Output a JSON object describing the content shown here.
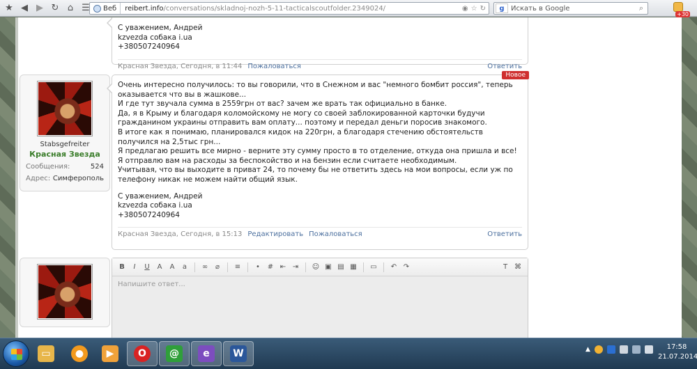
{
  "browser": {
    "site_label": "Веб",
    "url_host": "reibert.info",
    "url_path": "/conversations/skladnoj-nozh-5-11-tacticalscoutfolder.2349024/",
    "search_placeholder": "Искать в Google",
    "search_engine_letter": "g",
    "notif_count": "+30"
  },
  "prev_post": {
    "signature": [
      "С уважением, Андрей",
      "kzvezda собака i.ua",
      "+380507240964"
    ],
    "author_time": "Красная Звезда, Сегодня, в 11:44",
    "report": "Пожаловаться",
    "reply": "Ответить"
  },
  "post": {
    "badge": "Новое",
    "user": {
      "rank": "Stabsgefreiter",
      "name": "Красная Звезда",
      "messages_label": "Сообщения:",
      "messages_value": "524",
      "address_label": "Адрес:",
      "address_value": "Симферополь"
    },
    "lines": [
      "Очень интересно получилось: то вы говорили, что в Снежном и вас \"немного бомбит россия\", теперь",
      "оказывается что вы в жашкове...",
      "И где тут звучала сумма в 2559грн от вас? зачем же врать так официально в банке.",
      "Да, я в Крыму и благодаря коломойскому не могу со своей заблокированной карточки будучи",
      "гражданином украины отправить вам оплату... поэтому и передал деньги поросив знакомого.",
      "В итоге как я понимаю, планировался кидок на 220грн, а благодаря стечению обстоятельств",
      "получился на 2,5тыс грн...",
      "Я предлагаю решить все мирно - верните эту сумму просто в то отделение, откуда она пришла и все!",
      "Я отправлю вам на расходы за беспокойство и на бензин если считаете необходимым.",
      "Учитывая, что вы выходите в приват 24, то почему бы не ответить здесь на мои вопросы, если уж по",
      "телефону никак не можем найти общий язык."
    ],
    "signature": [
      "С уважением, Андрей",
      "kzvezda собака i.ua",
      "+380507240964"
    ],
    "author_time": "Красная Звезда, Сегодня, в 15:13",
    "edit": "Редактировать",
    "report": "Пожаловаться",
    "reply": "Ответить"
  },
  "editor": {
    "placeholder": "Напишите ответ..."
  },
  "taskbar": {
    "time": "17:58",
    "date": "21.07.2014"
  }
}
